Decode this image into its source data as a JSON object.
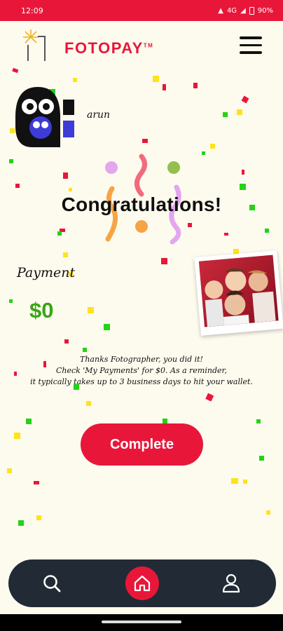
{
  "status_bar": {
    "time": "12:09",
    "network": "4G",
    "battery": "90%"
  },
  "header": {
    "logo_text": "FOTOPAY",
    "logo_tm": "TM",
    "menu_icon": "hamburger-menu-icon"
  },
  "profile": {
    "username": "arun"
  },
  "congrats": {
    "title": "Congratulations!"
  },
  "payment": {
    "label": "Payment",
    "amount": "$0"
  },
  "message": {
    "line1": "Thanks Fotographer, you did it!",
    "line2": "Check 'My Payments' for $0. As a reminder,",
    "line3": "it typically takes up to 3 business days to hit your wallet."
  },
  "actions": {
    "complete_label": "Complete"
  },
  "bottom_nav": {
    "items": [
      {
        "icon": "search-icon"
      },
      {
        "icon": "home-icon"
      },
      {
        "icon": "user-icon"
      }
    ]
  },
  "colors": {
    "brand": "#e8173a",
    "background": "#fdfbee",
    "payment": "#3aa516",
    "nav": "#222b35"
  }
}
